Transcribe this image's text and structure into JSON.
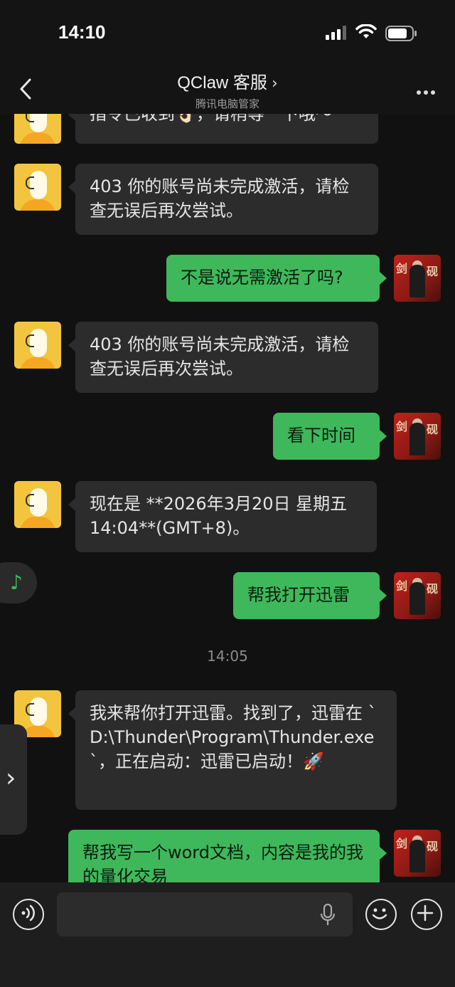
{
  "status_bar": {
    "time": "14:10"
  },
  "header": {
    "title": "QClaw 客服",
    "subtitle": "腾讯电脑管家"
  },
  "messages": [
    {
      "from": "bot",
      "text": "指令已收到👌🏻，请稍等一下哦～"
    },
    {
      "from": "bot",
      "text": "403 你的账号尚未完成激活，请检查无误后再次尝试。"
    },
    {
      "from": "me",
      "text": "不是说无需激活了吗?"
    },
    {
      "from": "bot",
      "text": "403 你的账号尚未完成激活，请检查无误后再次尝试。"
    },
    {
      "from": "me",
      "text": "看下时间"
    },
    {
      "from": "bot",
      "text": "现在是 **2026年3月20日 星期五 14:04**(GMT+8)。"
    },
    {
      "from": "me",
      "text": "帮我打开迅雷"
    },
    {
      "from": "bot",
      "text": "我来帮你打开迅雷。找到了，迅雷在 `D:\\Thunder\\Program\\Thunder.exe`，正在启动：迅雷已启动！🚀"
    },
    {
      "from": "me",
      "text": "帮我写一个word文档，内容是我的我的量化交易"
    }
  ],
  "timestamp": "14:05",
  "user_avatar_text": "剑 影 砚",
  "colors": {
    "background": "#111111",
    "bot_bubble": "#2c2c2c",
    "user_bubble": "#3eb85a",
    "bot_avatar": "#f3c53e",
    "user_avatar": "#c0221b"
  },
  "icons": {
    "back": "chevron-left-icon",
    "more": "more-dots-icon",
    "music": "music-note-icon",
    "side": "chevron-right-icon",
    "voice": "voice-icon",
    "mic": "microphone-icon",
    "emoji": "emoji-icon",
    "plus": "plus-icon"
  }
}
